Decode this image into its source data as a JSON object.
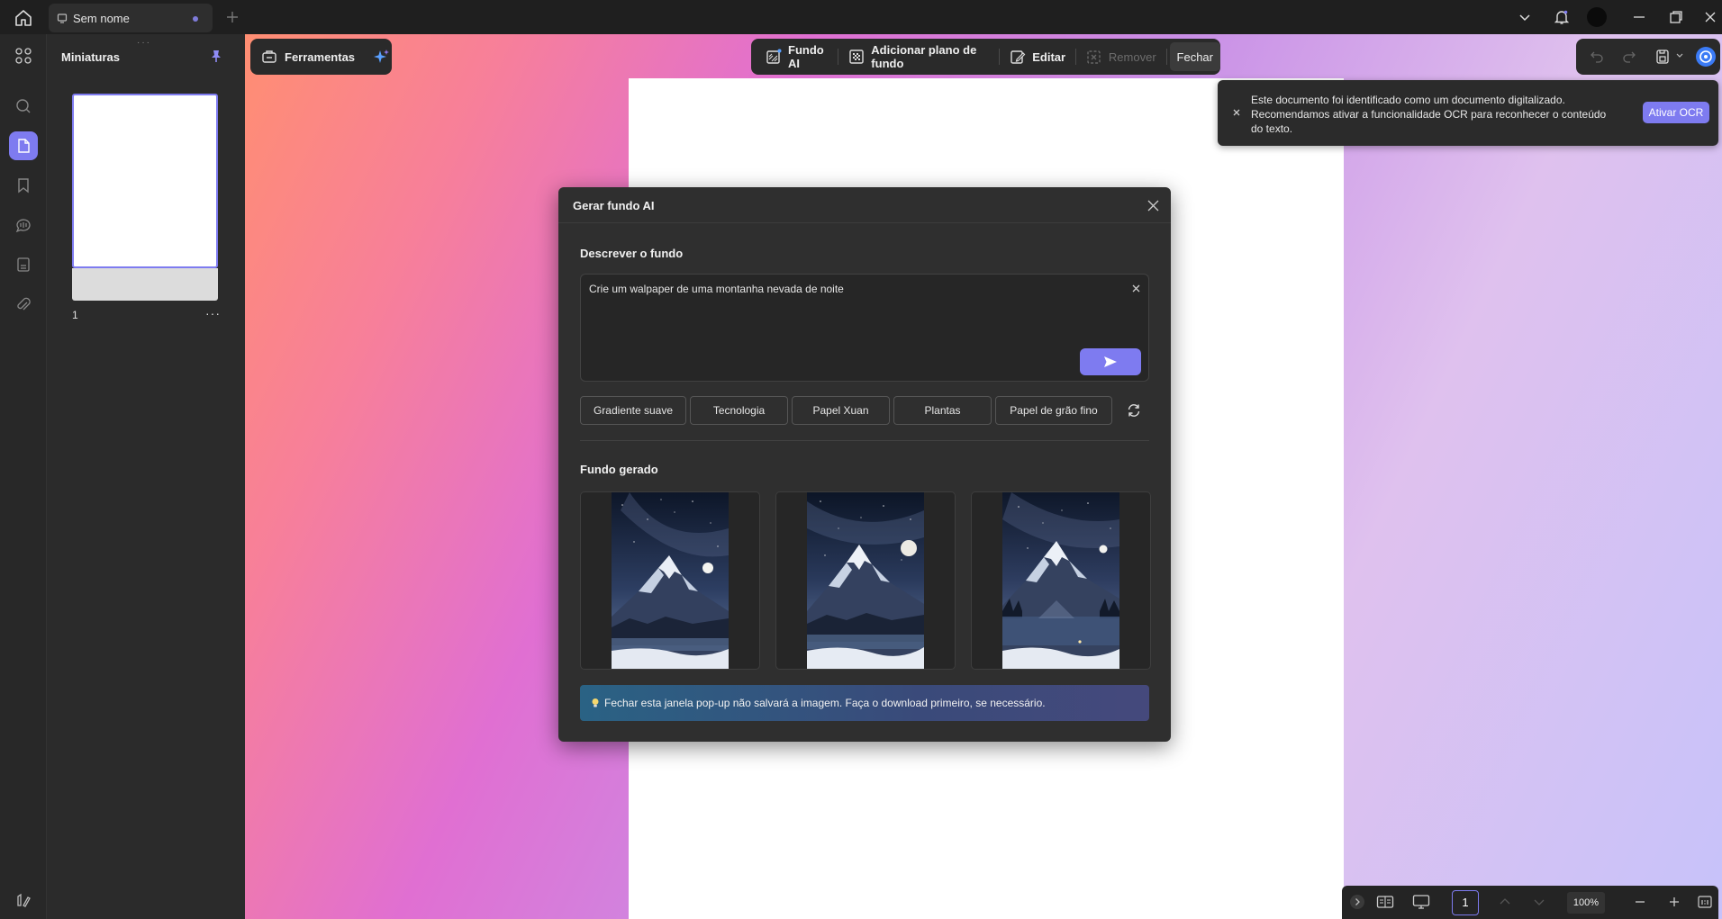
{
  "titlebar": {
    "tab_title": "Sem nome"
  },
  "thumbnails": {
    "title": "Miniaturas",
    "page_number": "1",
    "more_label": "···"
  },
  "toolbar": {
    "tools_label": "Ferramentas",
    "ai_background_label": "Fundo AI",
    "add_background_label": "Adicionar plano de fundo",
    "edit_label": "Editar",
    "remove_label": "Remover",
    "close_label": "Fechar"
  },
  "ocr_toast": {
    "message": "Este documento foi identificado como um documento digitalizado. Recomendamos ativar a funcionalidade OCR para reconhecer o conteúdo do texto.",
    "button_label": "Ativar OCR"
  },
  "dialog": {
    "title": "Gerar fundo AI",
    "describe_label": "Descrever o fundo",
    "prompt_value": "Crie um walpaper de uma montanha nevada de noite",
    "chips": [
      "Gradiente suave",
      "Tecnologia",
      "Papel Xuan",
      "Plantas",
      "Papel de grão fino"
    ],
    "generated_label": "Fundo gerado",
    "tip": "Fechar esta janela pop-up não salvará a imagem. Faça o download primeiro, se necessário."
  },
  "bottom_bar": {
    "page_value": "1",
    "zoom_value": "100%"
  },
  "colors": {
    "accent": "#7e7bf0",
    "dialog_bg": "#2f2f2f",
    "app_bg": "#1f1f1f"
  }
}
